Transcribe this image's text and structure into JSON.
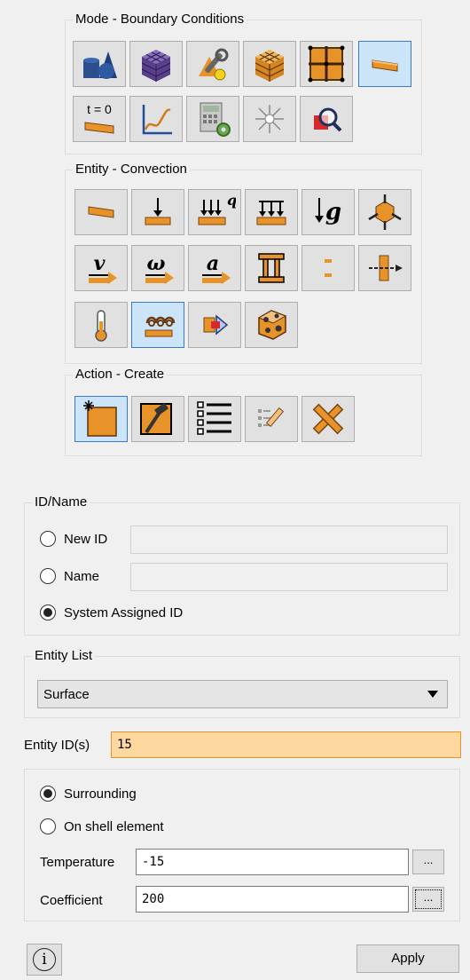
{
  "mode": {
    "title": "Mode - Boundary Conditions",
    "buttons": [
      {
        "name": "geometry-icon",
        "selected": false
      },
      {
        "name": "mesh-icon",
        "selected": false
      },
      {
        "name": "material-tools-icon",
        "selected": false
      },
      {
        "name": "element-cube-icon",
        "selected": false
      },
      {
        "name": "grid-nodes-icon",
        "selected": false
      },
      {
        "name": "boundary-conditions-icon",
        "selected": true
      },
      {
        "name": "initial-conditions-icon",
        "label": "t = 0",
        "selected": false
      },
      {
        "name": "curve-graph-icon",
        "selected": false
      },
      {
        "name": "calculator-settings-icon",
        "selected": false
      },
      {
        "name": "lighting-icon",
        "selected": false
      },
      {
        "name": "inspect-icon",
        "selected": false
      }
    ]
  },
  "entity": {
    "title": "Entity - Convection",
    "buttons": [
      {
        "name": "surface-load-icon",
        "selected": false
      },
      {
        "name": "force-icon",
        "selected": false
      },
      {
        "name": "heat-flux-icon",
        "label": "q",
        "selected": false
      },
      {
        "name": "pressure-icon",
        "selected": false
      },
      {
        "name": "gravity-icon",
        "label": "g",
        "selected": false
      },
      {
        "name": "constraint-icon",
        "selected": false
      },
      {
        "name": "velocity-icon",
        "label": "v",
        "selected": false
      },
      {
        "name": "angular-velocity-icon",
        "label": "ω",
        "selected": false
      },
      {
        "name": "acceleration-icon",
        "label": "a",
        "selected": false
      },
      {
        "name": "contact-icon",
        "selected": false
      },
      {
        "name": "displacement-icon",
        "selected": false
      },
      {
        "name": "connector-icon",
        "selected": false
      },
      {
        "name": "temperature-icon",
        "selected": false
      },
      {
        "name": "convection-icon",
        "selected": true
      },
      {
        "name": "radiation-icon",
        "selected": false
      },
      {
        "name": "heat-source-icon",
        "selected": false
      }
    ]
  },
  "action": {
    "title": "Action - Create",
    "buttons": [
      {
        "name": "create-icon",
        "selected": true
      },
      {
        "name": "modify-icon",
        "selected": false
      },
      {
        "name": "list-icon",
        "selected": false
      },
      {
        "name": "rename-icon",
        "selected": false
      },
      {
        "name": "delete-icon",
        "selected": false
      }
    ]
  },
  "id_name": {
    "title": "ID/Name",
    "new_id_label": "New ID",
    "new_id_value": "",
    "name_label": "Name",
    "name_value": "",
    "system_label": "System Assigned ID",
    "selected": "system"
  },
  "entity_list": {
    "title": "Entity List",
    "value": "Surface"
  },
  "entity_ids": {
    "label": "Entity ID(s)",
    "value": "15"
  },
  "convection": {
    "surrounding_label": "Surrounding",
    "shell_label": "On shell element",
    "selected": "surrounding",
    "temperature_label": "Temperature",
    "temperature_value": "-15",
    "coefficient_label": "Coefficient",
    "coefficient_value": "200",
    "browse_label": "..."
  },
  "footer": {
    "info_label": "i",
    "apply_label": "Apply"
  },
  "colors": {
    "accent": "#3b78c0",
    "selected_bg": "#cce4f7",
    "highlight_field": "#ffd8a0",
    "orange": "#e8932a"
  }
}
